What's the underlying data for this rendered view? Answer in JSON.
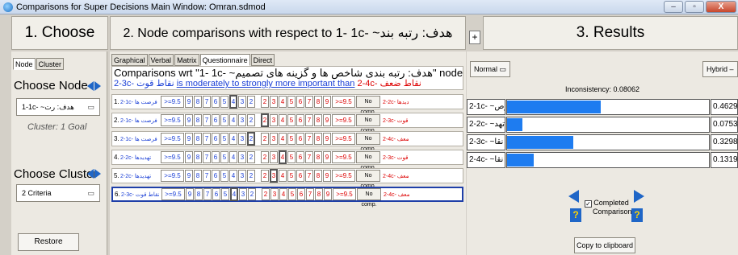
{
  "window": {
    "title": "Comparisons for Super Decisions Main Window: Omran.sdmod",
    "min": "–",
    "max": "▫",
    "close": "X"
  },
  "headers": {
    "choose": "1. Choose",
    "node_comparisons": "2. Node comparisons with respect to 1- 1c- ~هدف: رتبه بند",
    "results": "3. Results",
    "plus": "+"
  },
  "left": {
    "tabs": [
      "Node",
      "Cluster"
    ],
    "choose_node_label": "Choose Node",
    "node_value": "1-1c- ~هدف: رت",
    "node_note": "Cluster: 1 Goal",
    "choose_cluster_label": "Choose Cluster",
    "cluster_value": "2 Criteria",
    "restore": "Restore"
  },
  "middle": {
    "tabs": [
      "Graphical",
      "Verbal",
      "Matrix",
      "Questionnaire",
      "Direct"
    ],
    "line1": "Comparisons wrt \"1- 1c- ~هدف: رتبه بندی شاخص ها و گزینه های تصمیم\" node in \"2 Criteria\" cluster",
    "line2_left": "2-3c- نقاط قوت",
    "line2_mid": "is moderately to strongly more important than",
    "line2_right": "2-4c- نقاط ضعف",
    "rows": [
      {
        "num": "1.",
        "left": "2-1c- فرصت ها",
        "right": "2-2c- تهدیدها",
        "picked_side": "left",
        "picked_value": "4"
      },
      {
        "num": "2.",
        "left": "2-1c- فرصت ها",
        "right": "2-3c- نقاط قوت",
        "picked_side": "right",
        "picked_value": "2"
      },
      {
        "num": "3.",
        "left": "2-1c- فرصت ها",
        "right": "2-4c- نقاط ضعف",
        "picked_side": "left",
        "picked_value": "2"
      },
      {
        "num": "4.",
        "left": "2-2c- تهدیدها",
        "right": "2-3c- نقاط قوت",
        "picked_side": "right",
        "picked_value": "4"
      },
      {
        "num": "5.",
        "left": "2-2c- تهدیدها",
        "right": "2-4c- نقاط ضعف",
        "picked_side": "right",
        "picked_value": "3"
      },
      {
        "num": "6.",
        "left": "2-3c- نقاط قوت",
        "right": "2-4c- نقاط ضعف",
        "picked_side": "left",
        "picked_value": "4"
      }
    ],
    "scale_left": [
      ">=9.5",
      "9",
      "8",
      "7",
      "6",
      "5",
      "4",
      "3",
      "2"
    ],
    "scale_right": [
      "2",
      "3",
      "4",
      "5",
      "6",
      "7",
      "8",
      "9",
      ">=9.5"
    ],
    "center": "1",
    "no_comp": "No comp."
  },
  "right": {
    "mode_left": "Normal",
    "mode_right": "Hybrid",
    "inconsistency": "Inconsistency: 0.08062",
    "results": [
      {
        "label": "2-1c- ~فرص",
        "value": "0.4629",
        "fraction": 0.4629
      },
      {
        "label": "2-2c- ~تهد",
        "value": "0.0753",
        "fraction": 0.0753
      },
      {
        "label": "2-3c- ~نقا",
        "value": "0.3298",
        "fraction": 0.3298
      },
      {
        "label": "2-4c- ~نقا",
        "value": "0.1319",
        "fraction": 0.1319
      }
    ],
    "completed_label": "Completed Comparison",
    "copy": "Copy to clipboard",
    "help": "?",
    "check": "✓"
  },
  "colors": {
    "accent": "#1f66c7",
    "bar": "#1e7cf0",
    "red": "#dd0000",
    "blue": "#1a3fd6"
  }
}
